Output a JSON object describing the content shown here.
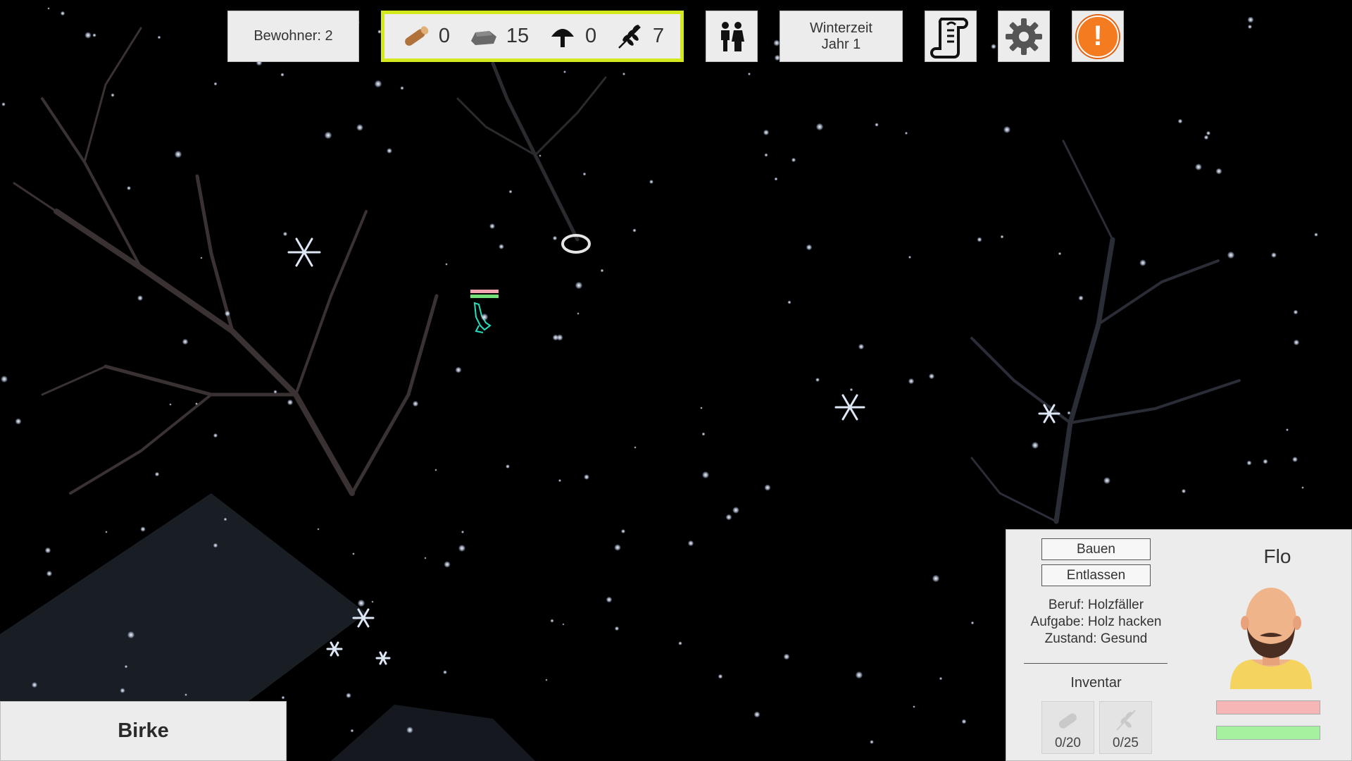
{
  "hud": {
    "residents_label": "Bewohner: 2",
    "resources": {
      "wood": {
        "icon": "wood-log-icon",
        "value": "0"
      },
      "stone": {
        "icon": "stone-icon",
        "value": "15"
      },
      "mushroom": {
        "icon": "mushroom-icon",
        "value": "0"
      },
      "grain": {
        "icon": "wheat-icon",
        "value": "7"
      }
    },
    "season_line1": "Winterzeit",
    "season_line2": "Jahr 1",
    "buttons": {
      "population": "people-icon",
      "quests": "scroll-icon",
      "settings": "gear-icon",
      "alert": "!"
    },
    "highlight_color": "#d4e81e",
    "alert_color": "#f47b20"
  },
  "selected_object": {
    "name": "Birke"
  },
  "character": {
    "name": "Flo",
    "build_label": "Bauen",
    "dismiss_label": "Entlassen",
    "job": "Beruf: Holzfäller",
    "task": "Aufgabe: Holz hacken",
    "condition": "Zustand: Gesund",
    "inventory_title": "Inventar",
    "inventory": [
      {
        "icon": "wood-log-icon",
        "count": "0/20"
      },
      {
        "icon": "wheat-icon",
        "count": "0/25"
      }
    ],
    "health_fraction": 1.0,
    "energy_fraction": 1.0,
    "health_color": "#f6b6b6",
    "energy_color": "#a4f2a0"
  }
}
